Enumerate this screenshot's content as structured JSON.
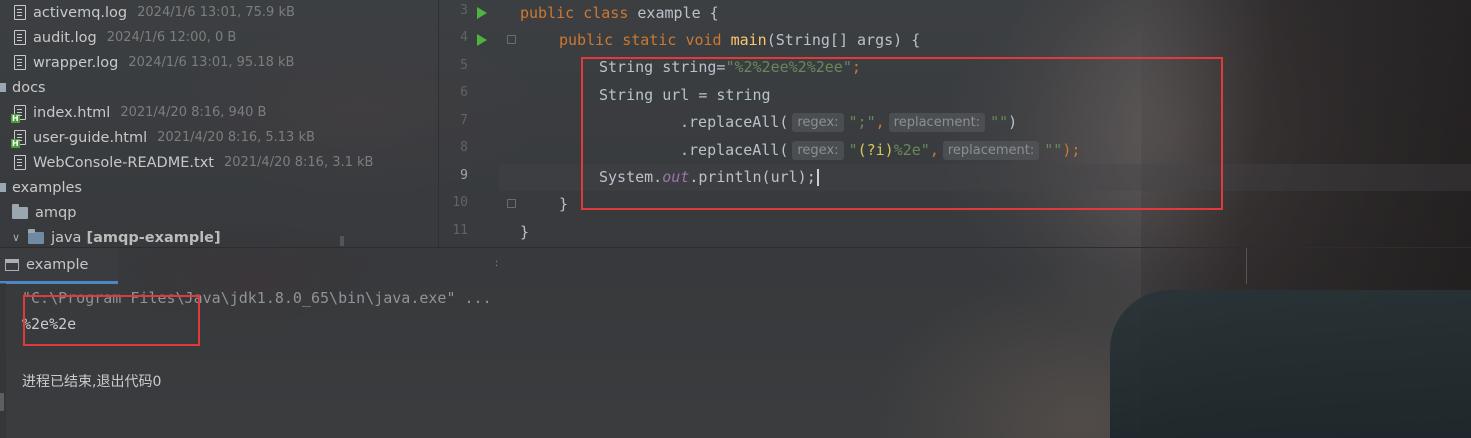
{
  "project_tree": {
    "items": [
      {
        "name": "activemq.log",
        "meta": "2024/1/6 13:01, 75.9 kB"
      },
      {
        "name": "audit.log",
        "meta": "2024/1/6 12:00, 0 B"
      },
      {
        "name": "wrapper.log",
        "meta": "2024/1/6 13:01, 95.18 kB"
      },
      {
        "name": "docs",
        "meta": ""
      },
      {
        "name": "index.html",
        "meta": "2021/4/20 8:16, 940 B"
      },
      {
        "name": "user-guide.html",
        "meta": "2021/4/20 8:16, 5.13 kB"
      },
      {
        "name": "WebConsole-README.txt",
        "meta": "2021/4/20 8:16, 3.1 kB"
      },
      {
        "name": "examples",
        "meta": ""
      },
      {
        "name": "amqp",
        "meta": ""
      },
      {
        "name": "java",
        "meta": "[amqp-example]"
      }
    ]
  },
  "editor": {
    "line_numbers": [
      "3",
      "4",
      "5",
      "6",
      "7",
      "8",
      "9",
      "10",
      "11"
    ],
    "lines": {
      "l3": {
        "kw1": "public",
        "kw2": "class",
        "rest": " example {"
      },
      "l4": {
        "kw1": "public",
        "kw2": "static",
        "kw3": "void",
        "fn": "main",
        "rest": "(String[] args) {"
      },
      "l5": {
        "pre": "String string=",
        "str": "\"%2%2ee%2%2ee\"",
        "post": ";"
      },
      "l6": {
        "text": "String url = string"
      },
      "l7": {
        "pre": ".replaceAll(",
        "hint1": "regex:",
        "str1": "\";\"",
        "sep": ",",
        "hint2": "replacement:",
        "str2": "\"\"",
        "post": ")"
      },
      "l8": {
        "pre": ".replaceAll(",
        "hint1": "regex:",
        "str1a": "\"",
        "str1b": "(?i)",
        "str1c": "%2e\"",
        "sep": ",",
        "hint2": "replacement:",
        "str2": "\"\"",
        "post": ");"
      },
      "l9": {
        "pre": "System.",
        "fld": "out",
        "post": ".println(url);"
      },
      "l10": {
        "text": "}"
      },
      "l11": {
        "text": "}"
      }
    }
  },
  "run_panel": {
    "tab_label": "example",
    "command": "\"C:\\Program Files\\Java\\jdk1.8.0_65\\bin\\java.exe\" ...",
    "output": "%2e%2e",
    "exit_message": "进程已结束,退出代码0"
  },
  "colors": {
    "keyword": "#cc7832",
    "method": "#ffc66d",
    "string": "#6a8759",
    "field": "#9876aa",
    "highlight_box": "#e03a3a",
    "run_arrow": "#4fb33f"
  }
}
